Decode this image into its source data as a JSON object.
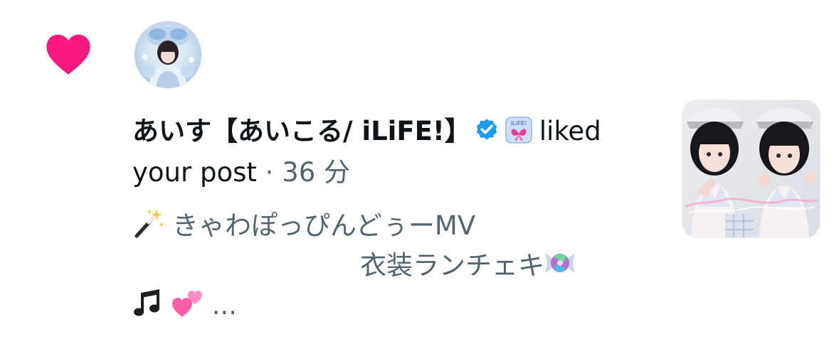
{
  "notification": {
    "icon": "heart-icon",
    "icon_color": "#f91880",
    "user": {
      "display_name": "あいす【あいこる/ iLiFE!】",
      "verified": true,
      "verified_color": "#1d9bf0",
      "affiliate_badge": "iLiFE!"
    },
    "action": "liked your post",
    "separator": "·",
    "time": "36 分",
    "post_preview": {
      "line1_emoji": "magic-wand-icon",
      "line1_text": "きゃわぽっぴんどぅーMV",
      "line2_text": "衣装ランチェキ",
      "line2_emoji": "candy-icon",
      "line3_emoji_1": "music-notes-icon",
      "line3_emoji_2": "two-hearts-icon",
      "ellipsis": "..."
    },
    "thumbnail": "post-thumbnail"
  },
  "colors": {
    "primary_text": "#0f1419",
    "secondary_text": "#536471",
    "accent": "#1d9bf0",
    "like": "#f91880"
  }
}
